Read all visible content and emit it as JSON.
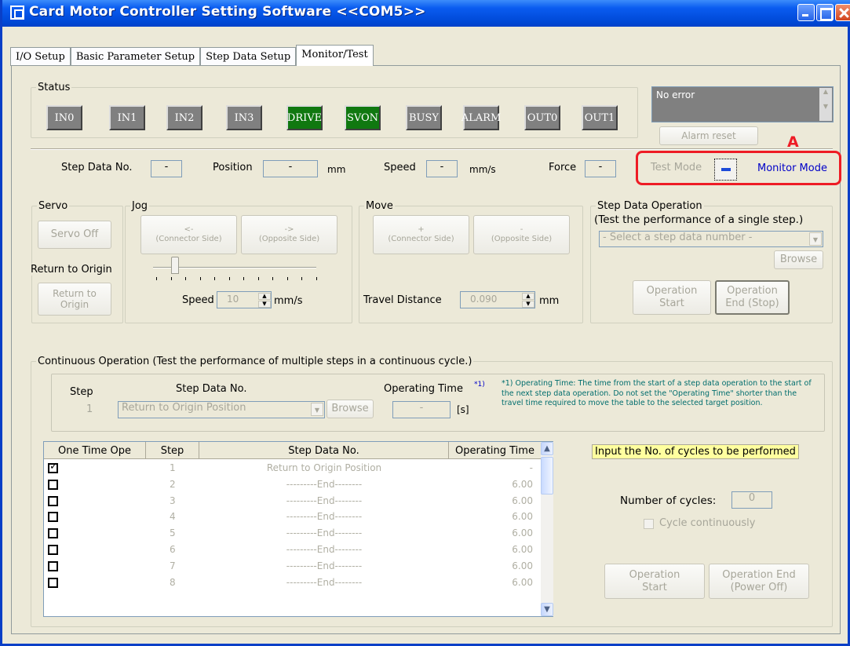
{
  "window": {
    "title": "Card Motor Controller Setting Software <<COM5>>"
  },
  "tabs": [
    "I/O Setup",
    "Basic Parameter Setup",
    "Step Data Setup",
    "Monitor/Test"
  ],
  "status": {
    "legend": "Status",
    "indicators": [
      {
        "label": "IN0",
        "on": false
      },
      {
        "label": "IN1",
        "on": false
      },
      {
        "label": "IN2",
        "on": false
      },
      {
        "label": "IN3",
        "on": false
      },
      {
        "label": "DRIVE",
        "on": true
      },
      {
        "label": "SVON",
        "on": true
      },
      {
        "label": "BUSY",
        "on": false
      },
      {
        "label": "ALARM",
        "on": false
      },
      {
        "label": "OUT0",
        "on": false
      },
      {
        "label": "OUT1",
        "on": false
      }
    ],
    "error_text": "No error",
    "alarm_reset": "Alarm reset"
  },
  "readout": {
    "step_label": "Step Data No.",
    "step_value": "-",
    "position_label": "Position",
    "position_value": "-",
    "position_unit": "mm",
    "speed_label": "Speed",
    "speed_value": "-",
    "speed_unit": "mm/s",
    "force_label": "Force",
    "force_value": "-",
    "test_mode": "Test Mode",
    "monitor_mode": "Monitor Mode"
  },
  "callout_label": "A",
  "servo": {
    "legend": "Servo",
    "servo_off": "Servo Off",
    "origin_label": "Return to Origin",
    "return_btn": [
      "Return to",
      "Origin"
    ]
  },
  "jog": {
    "legend": "Jog",
    "left_arrow": "<-",
    "left": "(Connector Side)",
    "right_arrow": "->",
    "right": "(Opposite Side)",
    "speed_label": "Speed",
    "speed_value": "10",
    "speed_unit": "mm/s"
  },
  "move": {
    "legend": "Move",
    "plus": "+",
    "left": "(Connector Side)",
    "minus": "-",
    "right": "(Opposite Side)",
    "travel_label": "Travel Distance",
    "travel_value": "0.090",
    "travel_unit": "mm"
  },
  "step_op": {
    "legend": "Step Data Operation",
    "desc": "(Test the performance of a single step.)",
    "select": "- Select a step data number -",
    "browse": "Browse",
    "start": [
      "Operation",
      "Start"
    ],
    "end": [
      "Operation",
      "End (Stop)"
    ]
  },
  "continuous": {
    "legend": "Continuous Operation (Test the performance of multiple steps in a continuous cycle.)",
    "step_label": "Step",
    "step_value": "1",
    "stepdata_label": "Step Data No.",
    "stepdata_value": "Return to Origin Position",
    "browse": "Browse",
    "optime_label": "Operating Time",
    "optime_sup": "*1)",
    "optime_value": "-",
    "optime_unit": "[s]",
    "note": "*1) Operating Time: The time from the start of a step data operation to the start of the next step data operation. Do not set the \"Operating Time\" shorter than the travel time required to move the table to the selected target position.",
    "columns": [
      "One Time Ope",
      "Step",
      "Step Data No.",
      "Operating Time"
    ],
    "rows": [
      {
        "checked": true,
        "step": "1",
        "data": "Return to Origin Position",
        "time": "-"
      },
      {
        "checked": false,
        "step": "2",
        "data": "---------End--------",
        "time": "6.00"
      },
      {
        "checked": false,
        "step": "3",
        "data": "---------End--------",
        "time": "6.00"
      },
      {
        "checked": false,
        "step": "4",
        "data": "---------End--------",
        "time": "6.00"
      },
      {
        "checked": false,
        "step": "5",
        "data": "---------End--------",
        "time": "6.00"
      },
      {
        "checked": false,
        "step": "6",
        "data": "---------End--------",
        "time": "6.00"
      },
      {
        "checked": false,
        "step": "7",
        "data": "---------End--------",
        "time": "6.00"
      },
      {
        "checked": false,
        "step": "8",
        "data": "---------End--------",
        "time": "6.00"
      }
    ],
    "cycles_hint": "Input the No. of cycles to be performed",
    "cycles_label": "Number of cycles:",
    "cycles_value": "0",
    "cycle_continuous": "Cycle continuously",
    "start": [
      "Operation",
      "Start"
    ],
    "end": [
      "Operation End",
      "(Power Off)"
    ]
  }
}
